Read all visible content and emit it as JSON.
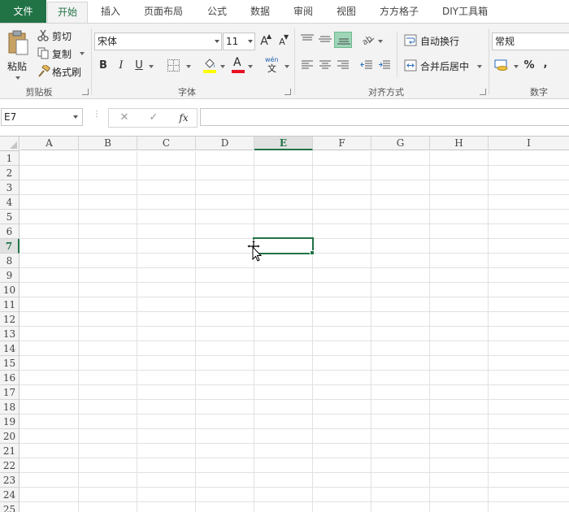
{
  "tabs": {
    "file": "文件",
    "home": "开始",
    "insert": "插入",
    "layout": "页面布局",
    "formulas": "公式",
    "data": "数据",
    "review": "审阅",
    "view": "视图",
    "fangfang": "方方格子",
    "diy": "DIY工具箱"
  },
  "clipboard": {
    "paste": "粘贴",
    "cut": "剪切",
    "copy": "复制",
    "format_painter": "格式刷",
    "group_label": "剪贴板"
  },
  "font": {
    "name": "宋体",
    "size": "11",
    "bold": "B",
    "italic": "I",
    "underline": "U",
    "increase": "A",
    "decrease": "A",
    "phonetic_top": "wén",
    "phonetic_bottom": "文",
    "group_label": "字体"
  },
  "alignment": {
    "wrap_text": "自动换行",
    "merge_center": "合并后居中",
    "group_label": "对齐方式"
  },
  "number": {
    "format": "常规",
    "percent": "%",
    "comma": ",",
    "group_label": "数字"
  },
  "formula_bar": {
    "name_box": "E7",
    "cancel": "✕",
    "enter": "✓",
    "fx": "fx",
    "content": ""
  },
  "columns": [
    "A",
    "B",
    "C",
    "D",
    "E",
    "F",
    "G",
    "H",
    "I"
  ],
  "rows": [
    "1",
    "2",
    "3",
    "4",
    "5",
    "6",
    "7",
    "8",
    "9",
    "10",
    "11",
    "12",
    "13",
    "14",
    "15",
    "16",
    "17",
    "18",
    "19",
    "20",
    "21",
    "22",
    "23",
    "24",
    "25"
  ],
  "selection": {
    "cell": "E7",
    "column": "E",
    "row": "7"
  },
  "colors": {
    "accent": "#217346",
    "font_color": "#e81123",
    "highlight": "#ffff00",
    "align_active": "#9fd5b7"
  }
}
